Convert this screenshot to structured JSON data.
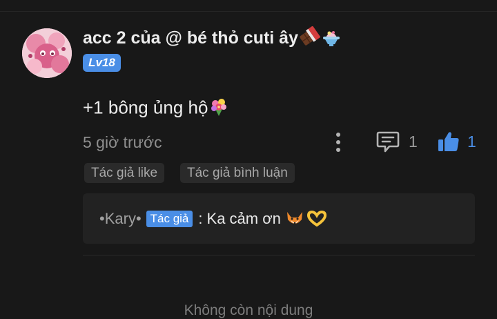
{
  "comment": {
    "username": "acc 2 của @ bé thỏ cuti ây",
    "username_emojis": [
      "chocolate-bar-emoji",
      "shaved-ice-emoji"
    ],
    "level": "Lv18",
    "text": "+1 bông ủng hộ",
    "text_emoji": "bouquet-emoji",
    "timestamp": "5 giờ trước",
    "reply_count": "1",
    "like_count": "1",
    "tags": [
      "Tác giả like",
      "Tác giả bình luận"
    ]
  },
  "reply": {
    "author": "•Kary•",
    "author_tag": "Tác giả",
    "separator": ":",
    "text": "Ka cảm ơn",
    "emojis": [
      "fox-emoji",
      "heart-hands-emoji"
    ]
  },
  "footer": {
    "end_text": "Không còn nội dung"
  },
  "colors": {
    "background": "#181818",
    "accent": "#4a8ee6",
    "muted": "#8f8f8f",
    "tag_bg": "#2a2a2a",
    "reply_box_bg": "#222222"
  }
}
